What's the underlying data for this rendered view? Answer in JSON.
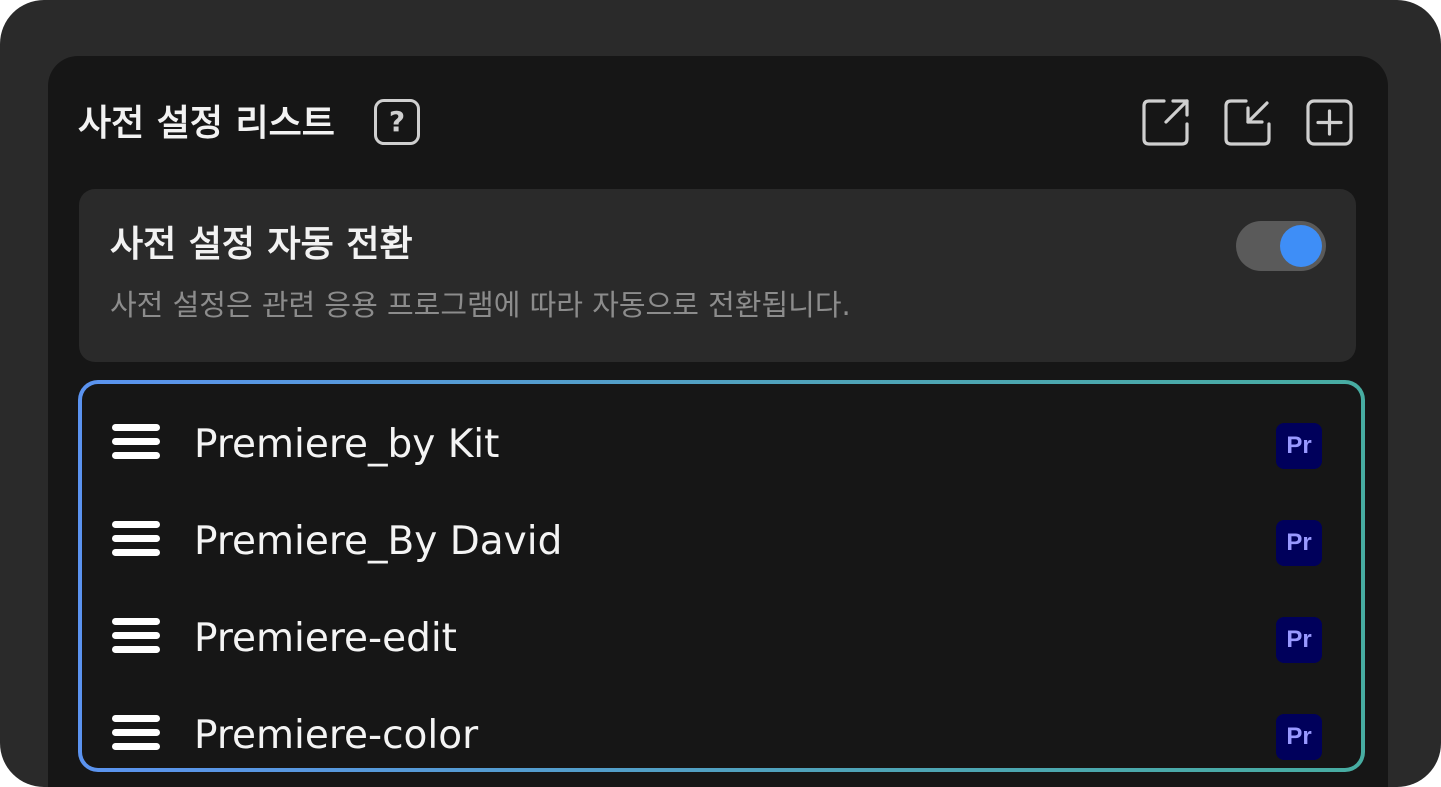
{
  "panel": {
    "title": "사전 설정 리스트",
    "help_label": "?",
    "toolbar": {
      "export_icon": "export-icon",
      "import_icon": "import-icon",
      "add_icon": "plus-square-icon"
    }
  },
  "auto_switch": {
    "title": "사전 설정 자동 전환",
    "description": "사전 설정은 관련 응용 프로그램에 따라 자동으로 전환됩니다.",
    "enabled": true,
    "accent_color": "#3e8ef7"
  },
  "presets": [
    {
      "label": "Premiere_by Kit",
      "app_badge": "Pr"
    },
    {
      "label": "Premiere_By David",
      "app_badge": "Pr"
    },
    {
      "label": "Premiere-edit",
      "app_badge": "Pr"
    },
    {
      "label": "Premiere-color",
      "app_badge": "Pr"
    }
  ],
  "colors": {
    "window_bg": "#2a2a2a",
    "panel_bg": "#161616",
    "list_border_start": "#5b93f0",
    "list_border_end": "#47ada2",
    "badge_bg": "#00005b",
    "badge_text": "#9999ff"
  }
}
